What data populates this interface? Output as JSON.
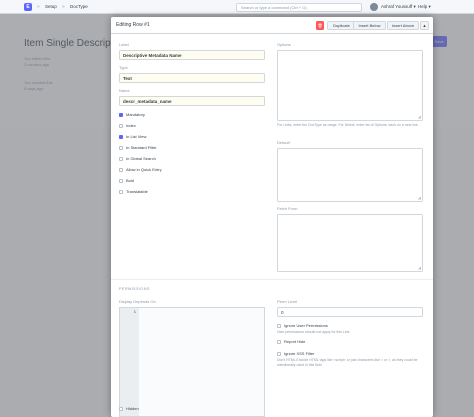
{
  "navbar": {
    "logo": "E",
    "breadcrumbs": [
      "Setup",
      "DocType"
    ],
    "breadcrumb_sep": ">",
    "search_placeholder": "Search or type a command (Ctrl + G)",
    "user_name": "Ashraf Youssuff",
    "user_caret": "▾",
    "help_label": "Help",
    "help_caret": "▾"
  },
  "background_page": {
    "title": "Item Single Descriptive",
    "edited_line1": "You edited this",
    "edited_line2": "2 minutes ago",
    "created_line1": "You created this",
    "created_line2": "5 days ago",
    "save_label": "Save"
  },
  "modal": {
    "title": "Editing Row #1",
    "delete_icon": "trash-icon",
    "delete_glyph": "🗑",
    "buttons": {
      "duplicate": "Duplicate",
      "insert_below": "Insert Below",
      "insert_above": "Insert Above"
    },
    "collapse_glyph": "▲",
    "fields": {
      "label": {
        "label": "Label",
        "value": "Descriptive Metadata Name"
      },
      "type": {
        "label": "Type",
        "value": "Text"
      },
      "name": {
        "label": "Name",
        "value": "descr_metadata_name"
      }
    },
    "checkboxes": [
      {
        "label": "Mandatory",
        "checked": true
      },
      {
        "label": "Index",
        "checked": false
      },
      {
        "label": "In List View",
        "checked": true
      },
      {
        "label": "In Standard Filter",
        "checked": false
      },
      {
        "label": "In Global Search",
        "checked": false
      },
      {
        "label": "Allow in Quick Entry",
        "checked": false
      },
      {
        "label": "Bold",
        "checked": false
      },
      {
        "label": "Translatable",
        "checked": false
      }
    ],
    "right": {
      "options_label": "Options",
      "options_help": "For Links, enter the DocType as range. For Select, enter list of Options, each on a new line.",
      "default_label": "Default",
      "fetch_from_label": "Fetch From"
    },
    "permissions": {
      "section_title": "PERMISSIONS",
      "display_depends_on_label": "Display Depends On",
      "code_line_number": "1",
      "perm_level_label": "Perm Level",
      "perm_level_value": "0",
      "ignore_user_permissions_label": "Ignore User Permissions",
      "ignore_user_permissions_help": "User permissions should not apply for this Link.",
      "report_hide_label": "Report Hide",
      "ignore_xss_label": "Ignore XSS Filter",
      "ignore_xss_help": "Don't HTML Encode HTML tags like <script> or just characters like < or >, as they could be intentionally used in this field",
      "hidden_label": "Hidden"
    }
  },
  "colors": {
    "primary": "#5e64ff",
    "danger": "#ff5858",
    "border": "#d1d8dd",
    "muted": "#8d99a6",
    "text": "#36414c"
  }
}
